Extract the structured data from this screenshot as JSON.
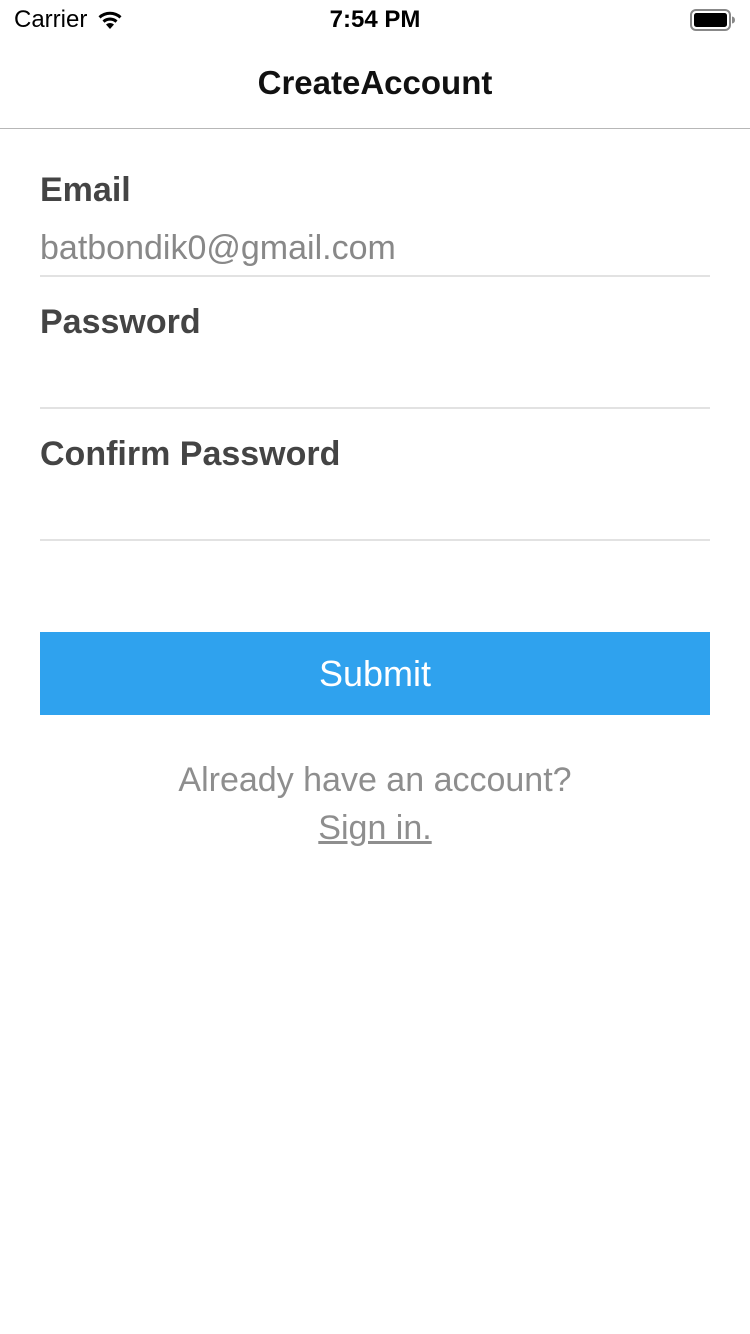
{
  "status_bar": {
    "carrier": "Carrier",
    "time": "7:54 PM",
    "icons": [
      "wifi-icon",
      "battery-icon"
    ]
  },
  "nav": {
    "title": "CreateAccount"
  },
  "form": {
    "email": {
      "label": "Email",
      "value": "batbondik0@gmail.com"
    },
    "password": {
      "label": "Password",
      "value": ""
    },
    "confirm_password": {
      "label": "Confirm Password",
      "value": ""
    }
  },
  "submit": {
    "label": "Submit"
  },
  "signin": {
    "prompt": "Already have an account?",
    "link": "Sign in."
  },
  "colors": {
    "accent": "#2fa2ee",
    "label": "#444444",
    "muted": "#8e8e8e",
    "divider": "#e2e2e2"
  }
}
